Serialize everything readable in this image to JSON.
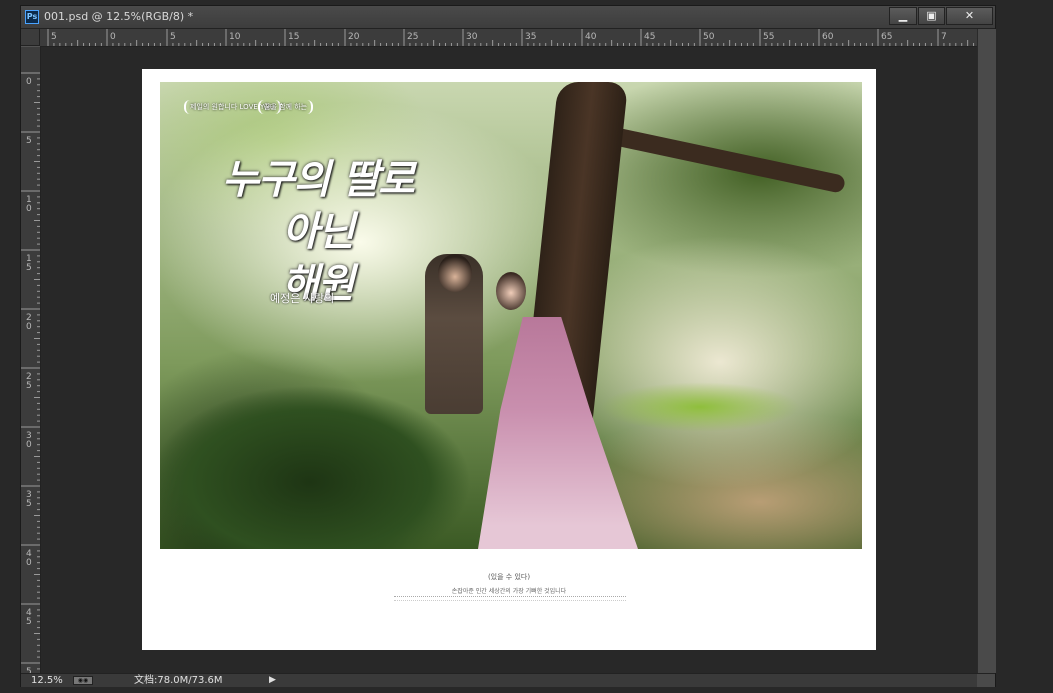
{
  "window": {
    "title": "001.psd @ 12.5%(RGB/8) *",
    "app_icon": "Ps",
    "buttons": {
      "minimize": "▁",
      "maximize": "▣",
      "close": "✕"
    }
  },
  "ruler": {
    "top_labels": [
      "5",
      "0",
      "5",
      "10",
      "15",
      "20",
      "25",
      "30",
      "35",
      "40",
      "45",
      "50",
      "55",
      "60",
      "65",
      "7"
    ],
    "left_labels": [
      "0",
      "5",
      "1\n0",
      "1\n5",
      "2\n0",
      "2\n5",
      "3\n0",
      "3\n5",
      "4\n0",
      "4\n5",
      "5"
    ]
  },
  "artwork": {
    "badge_left": "제일의 원합니다 LOVE YOU",
    "badge_right": "꿈을 함께 하는",
    "title_line1": "누구의 딸로 아닌",
    "title_line2": "해원",
    "subtitle": "예정은 사랑의",
    "caption_title": "(있을 수 있다)",
    "caption_line": "손잡아준 인간 세상간의 가장 기뻐한 것입니다"
  },
  "status": {
    "zoom": "12.5%",
    "doc_info": "文档:78.0M/73.6M",
    "arrow": "▶"
  }
}
